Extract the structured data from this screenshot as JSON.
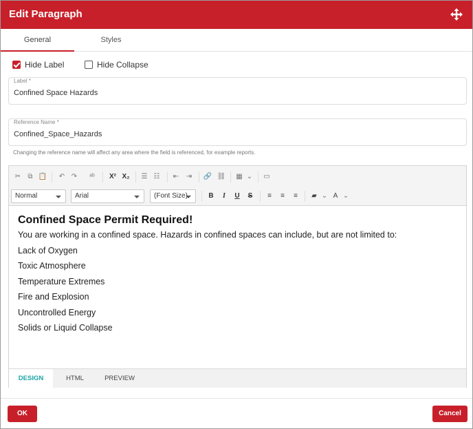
{
  "header": {
    "title": "Edit Paragraph",
    "move_icon": "move-arrows-icon"
  },
  "tabs": [
    {
      "label": "General",
      "active": true
    },
    {
      "label": "Styles",
      "active": false
    }
  ],
  "options": {
    "hide_label": {
      "label": "Hide Label",
      "checked": true
    },
    "hide_collapse": {
      "label": "Hide Collapse",
      "checked": false
    }
  },
  "fields": {
    "label": {
      "label": "Label *",
      "value": "Confined Space Hazards"
    },
    "reference_name": {
      "label": "Reference Name *",
      "value": "Confined_Space_Hazards"
    },
    "help": "Changing the reference name will affect any area where the field is referenced, for example reports."
  },
  "toolbar": {
    "format_select": "Normal",
    "font_select": "Arial",
    "size_select": "(Font Size)"
  },
  "content": {
    "heading": "Confined Space Permit Required!",
    "paragraphs": [
      "You are working in a confined space. Hazards in confined spaces can include, but are not limited to:",
      "Lack of Oxygen",
      "Toxic Atmosphere",
      "Temperature Extremes",
      "Fire and Explosion",
      "Uncontrolled Energy",
      "Solids or Liquid Collapse"
    ]
  },
  "modes": [
    {
      "label": "DESIGN",
      "active": true
    },
    {
      "label": "HTML",
      "active": false
    },
    {
      "label": "PREVIEW",
      "active": false
    }
  ],
  "footer": {
    "ok": "OK",
    "cancel": "Cancel"
  },
  "colors": {
    "brand": "#c8202a",
    "design_tab": "#1aa3a3"
  }
}
